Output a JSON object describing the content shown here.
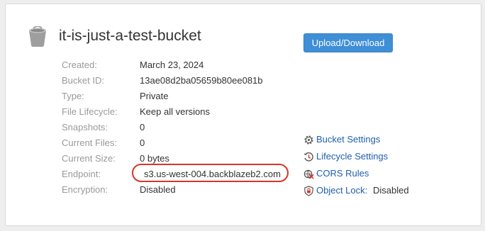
{
  "bucket": {
    "name": "it-is-just-a-test-bucket"
  },
  "actions": {
    "upload_label": "Upload/Download"
  },
  "properties": [
    {
      "label": "Created:",
      "value": "March 23, 2024"
    },
    {
      "label": "Bucket ID:",
      "value": "13ae08d2ba05659b80ee081b"
    },
    {
      "label": "Type:",
      "value": "Private"
    },
    {
      "label": "File Lifecycle:",
      "value": "Keep all versions"
    },
    {
      "label": "Snapshots:",
      "value": "0"
    },
    {
      "label": "Current Files:",
      "value": "0"
    },
    {
      "label": "Current Size:",
      "value": "0 bytes"
    },
    {
      "label": "Endpoint:",
      "value": "s3.us-west-004.backblazeb2.com"
    },
    {
      "label": "Encryption:",
      "value": "Disabled"
    }
  ],
  "links": [
    {
      "label": "Bucket Settings",
      "icon": "gear-icon"
    },
    {
      "label": "Lifecycle Settings",
      "icon": "clock-icon"
    },
    {
      "label": "CORS Rules",
      "icon": "cors-icon"
    },
    {
      "label": "Object Lock:",
      "icon": "shield-icon",
      "status": "Disabled"
    }
  ],
  "colors": {
    "accent": "#3f8fd6",
    "link": "#1f5fab",
    "highlight": "#d9342b"
  }
}
